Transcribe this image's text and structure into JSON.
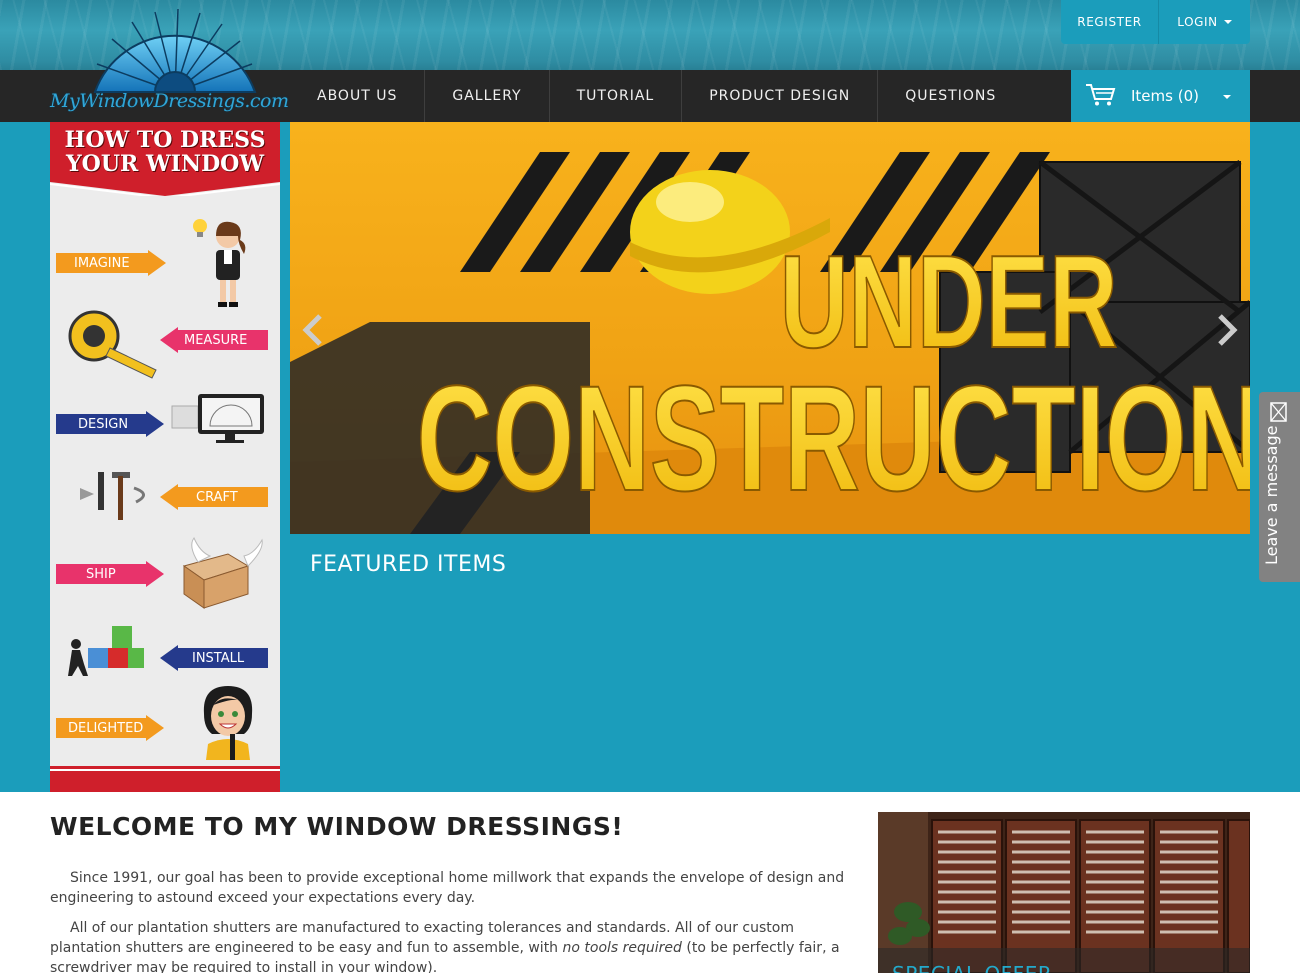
{
  "header": {
    "brand": "MyWindowDressings.com",
    "auth": {
      "register": "REGISTER",
      "login": "LOGIN"
    },
    "nav": [
      "ABOUT US",
      "GALLERY",
      "TUTORIAL",
      "PRODUCT DESIGN",
      "QUESTIONS"
    ],
    "cart": {
      "label": "Items (0)"
    }
  },
  "sidebar": {
    "title_line1": "HOW TO DRESS",
    "title_line2": "YOUR WINDOW",
    "steps": [
      "IMAGINE",
      "MEASURE",
      "DESIGN",
      "CRAFT",
      "SHIP",
      "INSTALL",
      "DELIGHTED"
    ]
  },
  "hero": {
    "word1": "UNDER",
    "word2": "CONSTRUCTION"
  },
  "featured": {
    "title": "FEATURED ITEMS"
  },
  "chat": {
    "label": "Leave a message"
  },
  "welcome": {
    "title": "WELCOME TO MY WINDOW DRESSINGS!",
    "p1": "Since 1991, our goal has been to provide exceptional home millwork that expands the envelope of design and engineering to astound exceed your expectations every day.",
    "p2_start": "All of our plantation shutters are manufactured to exacting tolerances and standards. All of our custom plantation shutters are engineered to be easy and fun to assemble, with ",
    "p2_em": "no tools required",
    "p2_end": " (to be perfectly fair, a screwdriver may be required to install in your window)."
  },
  "offer": {
    "caption": "SPECIAL OFFER"
  },
  "colors": {
    "teal": "#1b9dbb",
    "nav_dark": "#262626",
    "construction_yellow": "#f3a51a",
    "arrow_orange": "#f39a1e",
    "arrow_pink": "#e8336b",
    "arrow_navy": "#253a8c",
    "banner_red": "#cf1f2b"
  }
}
